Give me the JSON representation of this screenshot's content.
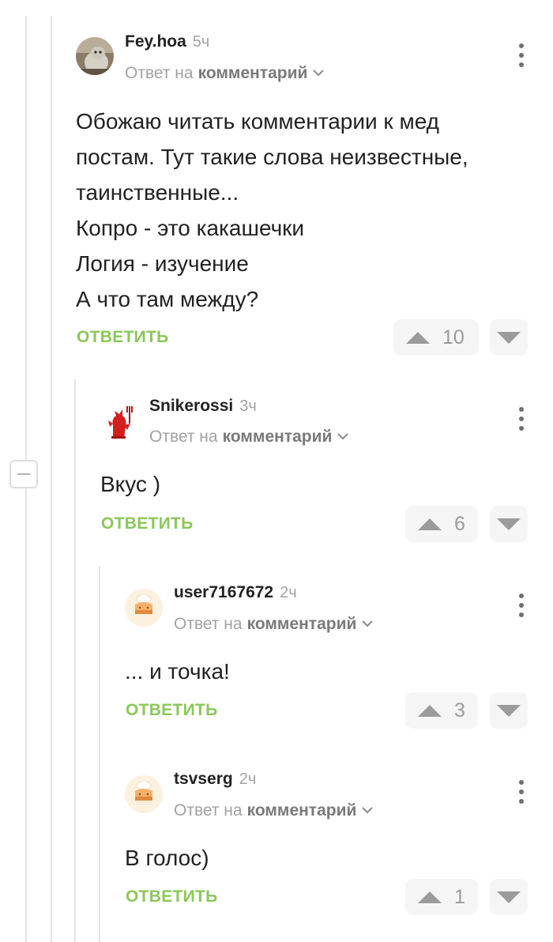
{
  "comments": [
    {
      "author": "Fey.hoa",
      "time": "5ч",
      "reply_prefix": "Ответ на",
      "reply_link": "комментарий",
      "body": [
        "Обожаю читать комментарии к мед",
        "постам. Тут такие слова неизвестные,",
        "таинственные...",
        "Копро - это какашечки",
        "Логия - изучение",
        "А что там между?"
      ],
      "reply_label": "ОТВЕТИТЬ",
      "votes": "10",
      "avatar_icon": "owl-photo-avatar"
    },
    {
      "author": "Snikerossi",
      "time": "3ч",
      "reply_prefix": "Ответ на",
      "reply_link": "комментарий",
      "body": [
        "Вкус )"
      ],
      "reply_label": "ОТВЕТИТЬ",
      "votes": "6",
      "avatar_icon": "red-dragon-avatar"
    },
    {
      "author": "user7167672",
      "time": "2ч",
      "reply_prefix": "Ответ на",
      "reply_link": "комментарий",
      "body": [
        "... и точка!"
      ],
      "reply_label": "ОТВЕТИТЬ",
      "votes": "3",
      "avatar_icon": "default-cake-avatar"
    },
    {
      "author": "tsvserg",
      "time": "2ч",
      "reply_prefix": "Ответ на",
      "reply_link": "комментарий",
      "body": [
        "В голос)"
      ],
      "reply_label": "ОТВЕТИТЬ",
      "votes": "1",
      "avatar_icon": "default-cake-avatar"
    }
  ],
  "colors": {
    "reply_green": "#8ac858",
    "muted_gray": "#a2a2a2",
    "vote_gray": "#9b9b9b",
    "thread_line": "#e4e4e4"
  },
  "icons": {
    "collapse": "minus-collapse-icon",
    "menu": "kebab-menu-icon",
    "chevron": "chevron-down-icon",
    "upvote": "upvote-triangle-icon",
    "downvote": "downvote-triangle-icon"
  }
}
